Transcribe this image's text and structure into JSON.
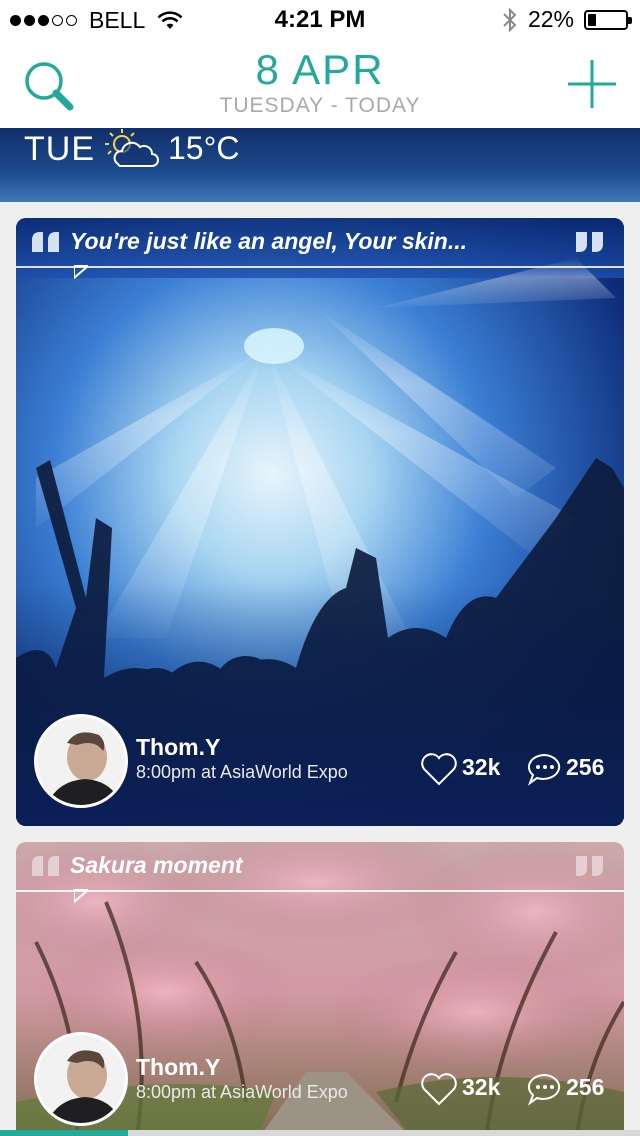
{
  "status_bar": {
    "signal_dots_full": 3,
    "signal_dots_total": 5,
    "carrier": "BELL",
    "time": "4:21 PM",
    "battery": "22%",
    "battery_level": 0.22,
    "icons": [
      "wifi-icon",
      "bluetooth-icon",
      "battery-icon"
    ]
  },
  "nav": {
    "date": "8 APR",
    "subtitle": "TUESDAY - TODAY",
    "left_icon": "search-icon",
    "right_icon": "add-icon",
    "accent_color": "#22a99a"
  },
  "weather": {
    "day": "TUE",
    "icon": "partly-sunny-icon",
    "temperature": "15°C"
  },
  "posts": [
    {
      "quote": "You're just like an angel, Your skin...",
      "user": "Thom.Y",
      "meta": "8:00pm at AsiaWorld Expo",
      "likes": "32k",
      "comments": "256",
      "image": "concert-crowd-photo"
    },
    {
      "quote": "Sakura moment",
      "user": "Thom.Y",
      "meta": "8:00pm at AsiaWorld Expo",
      "likes": "32k",
      "comments": "256",
      "image": "cherry-blossom-path-photo"
    }
  ],
  "scroll_progress": 0.2
}
